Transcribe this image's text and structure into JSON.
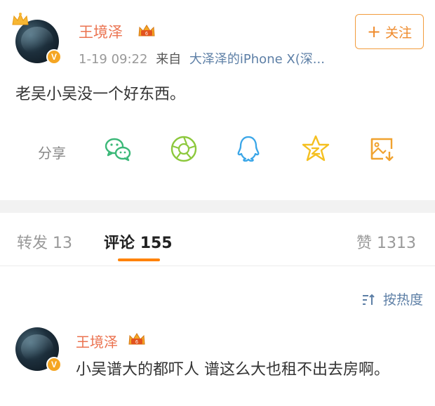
{
  "post": {
    "username": "王境泽",
    "time": "1-19 09:22",
    "source_prefix": "来自",
    "device": "大泽泽的iPhone X(深...",
    "follow_label": "关注",
    "follow_plus": "+",
    "content": "老吴小吴没一个好东西。",
    "verified_badge": "V"
  },
  "share": {
    "label": "分享",
    "icons": [
      "wechat-icon",
      "moments-icon",
      "qq-icon",
      "qzone-icon",
      "save-image-icon"
    ]
  },
  "tabs": {
    "repost_label": "转发",
    "repost_count": "13",
    "comment_label": "评论",
    "comment_count": "155",
    "like_label": "赞",
    "like_count": "1313"
  },
  "sort": {
    "label": "按热度"
  },
  "comment": {
    "username": "王境泽",
    "text": "小吴谱大的都吓人 谱这么大也租不出去房啊。",
    "verified_badge": "V"
  },
  "colors": {
    "accent": "#ff8200",
    "username": "#eb7350",
    "link": "#5d7fa6",
    "follow": "#ef8b2c"
  }
}
